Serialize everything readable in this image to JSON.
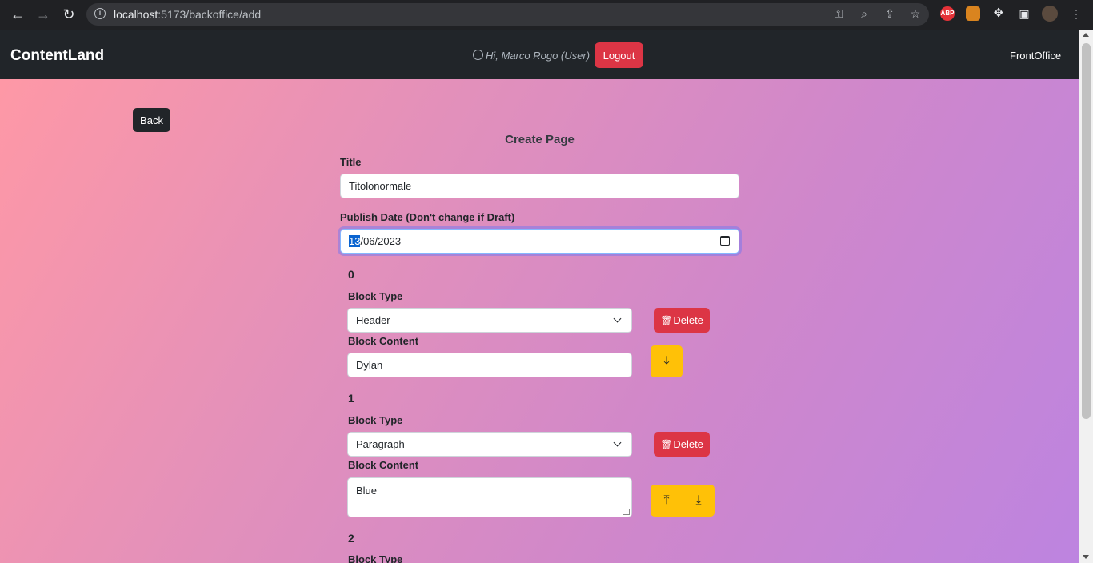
{
  "browser": {
    "url_host": "localhost",
    "url_rest": ":5173/backoffice/add",
    "ext_abp": "ABP"
  },
  "navbar": {
    "brand": "ContentLand",
    "greeting": "Hi, Marco Rogo (User)",
    "logout_label": "Logout",
    "frontoffice_label": "FrontOffice"
  },
  "page": {
    "back_label": "Back",
    "title": "Create Page",
    "title_label": "Title",
    "title_value": "Titolonormale",
    "publish_label": "Publish Date (Don't change if Draft)",
    "date_day": "13",
    "date_rest": "/06/2023"
  },
  "blocks": [
    {
      "index": "0",
      "type_label": "Block Type",
      "type_value": "Header",
      "delete_label": "Delete",
      "content_label": "Block Content",
      "content_value": "Dylan"
    },
    {
      "index": "1",
      "type_label": "Block Type",
      "type_value": "Paragraph",
      "delete_label": "Delete",
      "content_label": "Block Content",
      "content_value": "Blue"
    },
    {
      "index": "2",
      "type_label": "Block Type"
    }
  ],
  "colors": {
    "navbar_bg": "#212529",
    "danger": "#dc3545",
    "warning": "#ffc107",
    "gradient_start": "#fe98a6",
    "gradient_end": "#bd84e0"
  }
}
